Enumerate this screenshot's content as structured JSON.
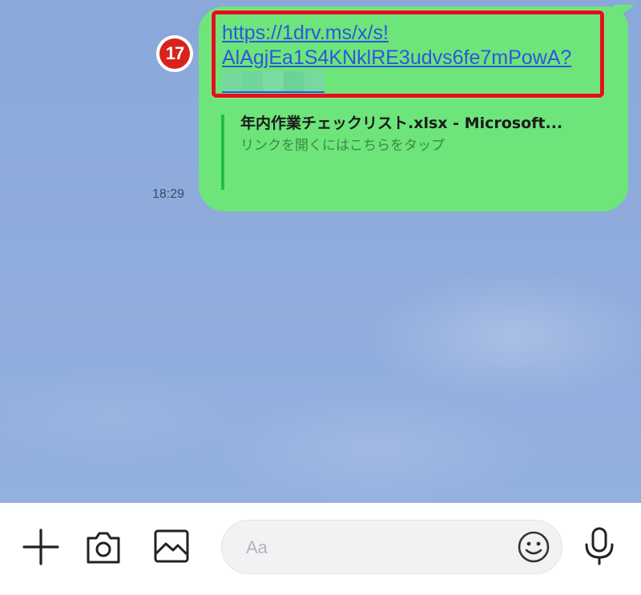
{
  "message": {
    "link_line1": "https://1drv.ms/x/s!",
    "link_line2": "AlAgjEa1S4KNklRE3udvs6fe7mPowA?",
    "preview_title": "年内作業チェックリスト.xlsx - Microsoft...",
    "preview_subtitle": "リンクを開くにはこちらをタップ",
    "timestamp": "18:29"
  },
  "annotation": {
    "step_number": "17"
  },
  "input_bar": {
    "placeholder": "Aa",
    "buttons": [
      "plus-icon",
      "camera-icon",
      "image-icon",
      "emoji-icon",
      "microphone-icon"
    ]
  },
  "colors": {
    "bubble": "#6de57a",
    "link": "#2f55e0",
    "highlight": "#e5101e",
    "preview_bar": "#1fbf45"
  }
}
